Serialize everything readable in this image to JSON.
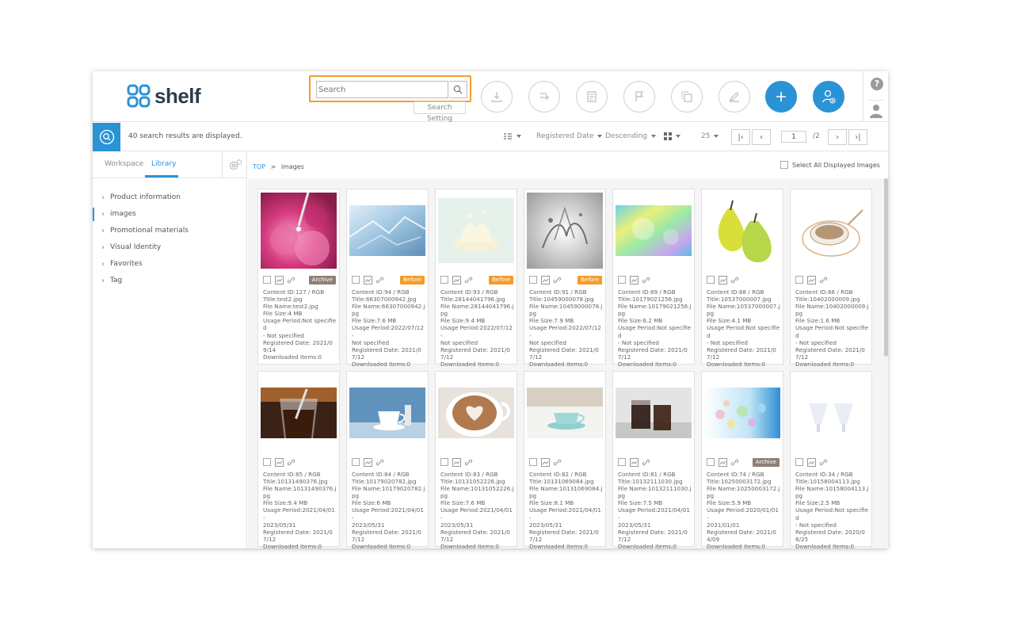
{
  "header": {
    "logo_text": "shelf",
    "search": {
      "placeholder": "Search",
      "setting_label": "Search Setting"
    },
    "tools": [
      {
        "name": "download-icon"
      },
      {
        "name": "move-icon"
      },
      {
        "name": "document-icon"
      },
      {
        "name": "flag-icon"
      },
      {
        "name": "copy-icon"
      },
      {
        "name": "edit-icon"
      },
      {
        "name": "add-icon"
      },
      {
        "name": "add-user-icon"
      }
    ],
    "help_label": "?"
  },
  "toolbar": {
    "results_text": "40 search results are displayed.",
    "sort_field": "Registered Date",
    "sort_order": "Descending",
    "per_page": "25",
    "page": "1",
    "total_pages": "/2"
  },
  "left": {
    "tabs": [
      {
        "label": "Workspace"
      },
      {
        "label": "Library"
      }
    ],
    "tree": [
      {
        "label": "Product information"
      },
      {
        "label": "images"
      },
      {
        "label": "Promotional materials"
      },
      {
        "label": "Visual Identity"
      },
      {
        "label": "Favorites"
      },
      {
        "label": "Tag"
      }
    ]
  },
  "main": {
    "breadcrumb_top": "TOP",
    "breadcrumb_sep": ">",
    "breadcrumb_current": "images",
    "select_all_label": "Select All Displayed Images",
    "cards": [
      {
        "badge": "Archive",
        "badge_type": "archive",
        "thumb": "pink-flower",
        "l1": "Content ID:127 / RGB",
        "l2": "Title:test2.jpg",
        "l3": "File Name:test2.jpg",
        "l4": "File Size:4 MB",
        "l5": "Usage Period:Not specified",
        "l6": "- Not specified",
        "l7": "Registered Date: 2021/09/14",
        "l8": "Downloaded Items:0"
      },
      {
        "badge": "Before",
        "badge_type": "before",
        "thumb": "ice",
        "l1": "Content ID:94 / RGB",
        "l2": "Title:66307000942.jpg",
        "l3": "File Name:66307000942.jpg",
        "l4": "File Size:7.6 MB",
        "l5": "Usage Period:2022/07/12 -",
        "l6": "Not specified",
        "l7": "Registered Date: 2021/07/12",
        "l8": "Downloaded Items:0"
      },
      {
        "badge": "Before",
        "badge_type": "before",
        "thumb": "milk-splash",
        "l1": "Content ID:93 / RGB",
        "l2": "Title:28144041796.jpg",
        "l3": "File Name:28144041796.jpg",
        "l4": "File Size:9.4 MB",
        "l5": "Usage Period:2022/07/12 -",
        "l6": "Not specified",
        "l7": "Registered Date: 2021/07/12",
        "l8": "Downloaded Items:0"
      },
      {
        "badge": "Before",
        "badge_type": "before",
        "thumb": "water-splash",
        "l1": "Content ID:91 / RGB",
        "l2": "Title:10459000078.jpg",
        "l3": "File Name:10459000078.jpg",
        "l4": "File Size:7.9 MB",
        "l5": "Usage Period:2022/07/12 -",
        "l6": "Not specified",
        "l7": "Registered Date: 2021/07/12",
        "l8": "Downloaded Items:0"
      },
      {
        "badge": "",
        "badge_type": "",
        "thumb": "prism",
        "l1": "Content ID:89 / RGB",
        "l2": "Title:10179021256.jpg",
        "l3": "File Name:10179021256.jpg",
        "l4": "File Size:6.2 MB",
        "l5": "Usage Period:Not specified",
        "l6": "- Not specified",
        "l7": "Registered Date: 2021/07/12",
        "l8": "Downloaded Items:0"
      },
      {
        "badge": "",
        "badge_type": "",
        "thumb": "pears",
        "l1": "Content ID:88 / RGB",
        "l2": "Title:10537000007.jpg",
        "l3": "File Name:10537000007.jpg",
        "l4": "File Size:4.1 MB",
        "l5": "Usage Period:Not specified",
        "l6": "- Not specified",
        "l7": "Registered Date: 2021/07/12",
        "l8": "Downloaded Items:0"
      },
      {
        "badge": "",
        "badge_type": "",
        "thumb": "soup",
        "l1": "Content ID:86 / RGB",
        "l2": "Title:10402000009.jpg",
        "l3": "File Name:10402000009.jpg",
        "l4": "File Size:1.6 MB",
        "l5": "Usage Period:Not specified",
        "l6": "- Not specified",
        "l7": "Registered Date: 2021/07/12",
        "l8": "Downloaded Items:0"
      },
      {
        "badge": "",
        "badge_type": "",
        "thumb": "iced-coffee",
        "l1": "Content ID:85 / RGB",
        "l2": "Title:10131490376.jpg",
        "l3": "File Name:10131490376.jpg",
        "l4": "File Size:9.4 MB",
        "l5": "Usage Period:2021/04/01 -",
        "l6": "2023/05/31",
        "l7": "Registered Date: 2021/07/12",
        "l8": "Downloaded Items:0"
      },
      {
        "badge": "",
        "badge_type": "",
        "thumb": "cup-blue",
        "l1": "Content ID:84 / RGB",
        "l2": "Title:10179020782.jpg",
        "l3": "File Name:10179020782.jpg",
        "l4": "File Size:6 MB",
        "l5": "Usage Period:2021/04/01 -",
        "l6": "2023/05/31",
        "l7": "Registered Date: 2021/07/12",
        "l8": "Downloaded Items:0"
      },
      {
        "badge": "",
        "badge_type": "",
        "thumb": "latte",
        "l1": "Content ID:83 / RGB",
        "l2": "Title:10131052226.jpg",
        "l3": "File Name:10131052226.jpg",
        "l4": "File Size:7.6 MB",
        "l5": "Usage Period:2021/04/01 -",
        "l6": "2023/05/31",
        "l7": "Registered Date: 2021/07/12",
        "l8": "Downloaded Items:0"
      },
      {
        "badge": "",
        "badge_type": "",
        "thumb": "teacup",
        "l1": "Content ID:82 / RGB",
        "l2": "Title:10131069084.jpg",
        "l3": "File Name:10131069084.jpg",
        "l4": "File Size:8.1 MB",
        "l5": "Usage Period:2021/04/01 -",
        "l6": "2023/05/31",
        "l7": "Registered Date: 2021/07/12",
        "l8": "Downloaded Items:0"
      },
      {
        "badge": "",
        "badge_type": "",
        "thumb": "cola",
        "l1": "Content ID:81 / RGB",
        "l2": "Title:10132111030.jpg",
        "l3": "File Name:10132111030.jpg",
        "l4": "File Size:7.5 MB",
        "l5": "Usage Period:2021/04/01 -",
        "l6": "2023/05/31",
        "l7": "Registered Date: 2021/07/12",
        "l8": "Downloaded Items:0"
      },
      {
        "badge": "Archive",
        "badge_type": "archive",
        "thumb": "bubbles",
        "l1": "Content ID:74 / RGB",
        "l2": "Title:10250003172.jpg",
        "l3": "File Name:10250003172.jpg",
        "l4": "File Size:5.9 MB",
        "l5": "Usage Period:2020/01/01 -",
        "l6": "2031/01/01",
        "l7": "Registered Date: 2021/04/09",
        "l8": "Downloaded Items:0"
      },
      {
        "badge": "",
        "badge_type": "",
        "thumb": "cups-white",
        "l1": "Content ID:34 / RGB",
        "l2": "Title:10158004113.jpg",
        "l3": "File Name:10158004113.jpg",
        "l4": "File Size:2.5 MB",
        "l5": "Usage Period:Not specified",
        "l6": "- Not specified",
        "l7": "Registered Date: 2020/08/25",
        "l8": "Downloaded Items:0"
      }
    ]
  },
  "colors": {
    "accent": "#2a93d6",
    "highlight": "#f39c2a",
    "archive": "#8e8078"
  }
}
